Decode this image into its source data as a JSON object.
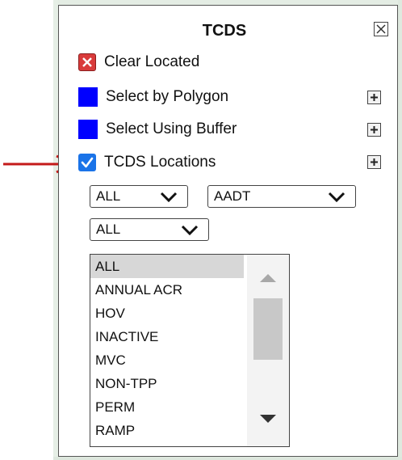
{
  "panel": {
    "title": "TCDS",
    "rows": [
      {
        "label": "Clear Located",
        "icon": "clear-x-icon"
      },
      {
        "label": "Select by Polygon",
        "icon": "blue-square-icon"
      },
      {
        "label": "Select Using Buffer",
        "icon": "blue-square-icon"
      },
      {
        "label": "TCDS Locations",
        "icon": "checkbox-checked-icon"
      }
    ],
    "filters": {
      "select_1": "ALL",
      "select_2": "AADT",
      "select_3": "ALL"
    },
    "list_items": [
      "ALL",
      "ANNUAL ACR",
      "HOV",
      "INACTIVE",
      "MVC",
      "NON-TPP",
      "PERM",
      "RAMP"
    ],
    "selected_item": "ALL"
  },
  "colors": {
    "accent_blue": "#0000ff",
    "checkbox_blue": "#1a73e8",
    "clear_red": "#d93b3b",
    "pointer_red": "#c41a1a"
  }
}
